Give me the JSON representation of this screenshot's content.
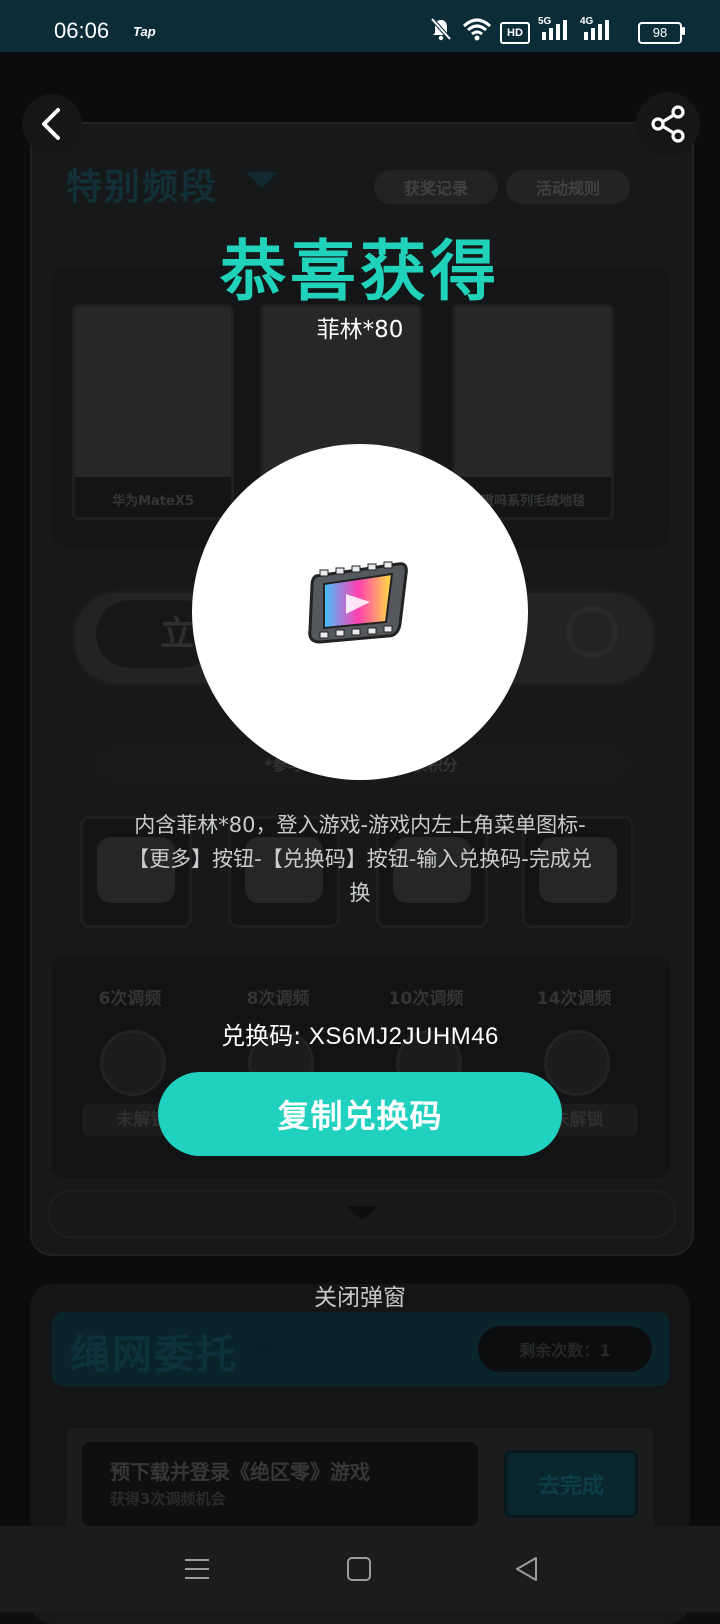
{
  "status_bar": {
    "time": "06:06",
    "app_badge": "Tap",
    "battery": "98",
    "network_5g": "5G",
    "network_4g": "4G",
    "hd": "HD"
  },
  "background": {
    "section_title": "特别频段",
    "records_button": "获奖记录",
    "rules_button": "活动规则",
    "prizes": [
      {
        "label": "华为MateX5"
      },
      {
        "label": ""
      },
      {
        "label": "嗷呜系列毛绒地毯"
      }
    ],
    "draw_button_partial": "立",
    "notice": "*参与「特别频段」                       兑换积分",
    "milestones": [
      {
        "label": "6次调频",
        "button": "未解锁"
      },
      {
        "label": "8次调频",
        "button": ""
      },
      {
        "label": "10次调频",
        "button": ""
      },
      {
        "label": "14次调频",
        "button": "未解锁"
      }
    ],
    "task_section_title": "绳网委托",
    "remaining_count": "剩余次数：1",
    "task": {
      "title": "预下载并登录《绝区零》游戏",
      "subtitle": "获得3次调频机会",
      "button": "去完成"
    }
  },
  "modal": {
    "title": "恭喜获得",
    "prize_name": "菲林*80",
    "description": "内含菲林*80，登入游戏-游戏内左上角菜单图标-【更多】按钮-【兑换码】按钮-输入兑换码-完成兑换",
    "code_label": "兑换码: ",
    "code_value": "XS6MJ2JUHM46",
    "copy_button": "复制兑换码",
    "close_link": "关闭弹窗"
  },
  "colors": {
    "accent": "#1fd2b9",
    "button": "#1fd1be",
    "overlay": "#0c0e10"
  },
  "icons": {
    "back": "chevron-left-icon",
    "share": "share-icon",
    "prize": "film-reel-icon"
  }
}
